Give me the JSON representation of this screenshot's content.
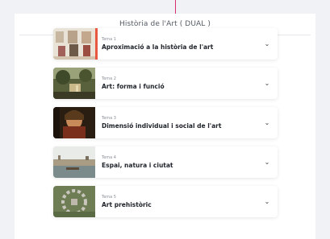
{
  "course_title": "Història de l'Art ( DUAL )",
  "topics": [
    {
      "kicker": "Tema 1",
      "label": "Aproximació a la història de l'art",
      "icon": "chevron-down-icon"
    },
    {
      "kicker": "Tema 2",
      "label": "Art: forma i funció",
      "icon": "chevron-down-icon"
    },
    {
      "kicker": "Tema 3",
      "label": "Dimensió individual i social de l'art",
      "icon": "chevron-down-icon"
    },
    {
      "kicker": "Tema 4",
      "label": "Espai, natura i ciutat",
      "icon": "chevron-down-icon"
    },
    {
      "kicker": "Tema 5",
      "label": "Art prehistòric",
      "icon": "chevron-down-icon"
    }
  ],
  "colors": {
    "accent": "#e8573f",
    "top_line": "#d8306b"
  }
}
